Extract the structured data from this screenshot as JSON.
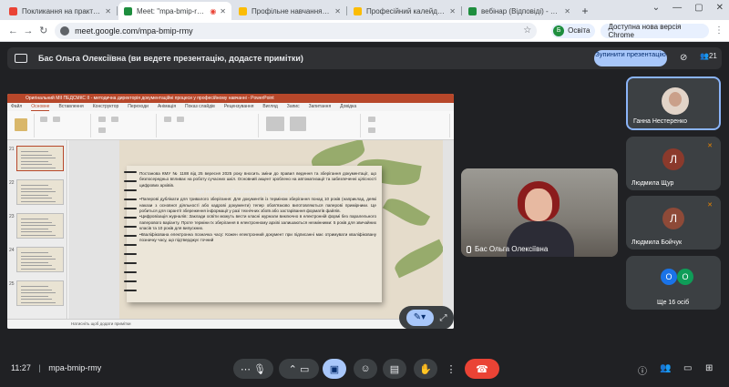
{
  "browser": {
    "tabs": [
      {
        "title": "Покликання на практикум - с",
        "color": "#ea4335",
        "active": false
      },
      {
        "title": "Meet: \"mpa-bmip-rmy\"",
        "color": "#1e8e3e",
        "active": true
      },
      {
        "title": "Профільне навчання - lino",
        "color": "#fbbc04",
        "active": false
      },
      {
        "title": "Професійний калейдоскоп - ",
        "color": "#fbbc04",
        "active": false
      },
      {
        "title": "вебінар (Відповіді) - Google Та",
        "color": "#1e8e3e",
        "active": false
      }
    ],
    "url": "meet.google.com/mpa-bmip-rmy",
    "profile_initial": "Б",
    "profile_label": "Освіта",
    "update_label": "Доступна нова версія Chrome"
  },
  "banner": {
    "text": "Бас Ольга Олексіївна (ви ведете презентацію, додасте примітки)",
    "stop_label": "Зупинити презентацію",
    "participants_count": "21"
  },
  "presentation": {
    "window_title": "Оригінальний МІІ ПЕДСМКС ІІ - методична директорія документаційні процеси у професійному навчанні - PowerPoint",
    "ribbon_tabs": [
      "Файл",
      "Основне",
      "Вставлення",
      "Конструктор",
      "Переходи",
      "Анімація",
      "Показ слайдів",
      "Рецензування",
      "Вигляд",
      "Запис",
      "Запитання",
      "Довідка"
    ],
    "active_ribbon_tab": "Основне",
    "thumb_numbers": [
      "21",
      "22",
      "23",
      "24",
      "25"
    ],
    "status": "Натисніть щоб додати примітки",
    "slide": {
      "intro": "Постанова КМУ № 1188 від 25 вересня 2025 року вносить зміни до правил ведення та зберігання документації, що безпосередньо впливає на роботу сучасних шкіл. Основний акцент зроблено на автоматизації та забезпеченні цілісності цифрових архівів.",
      "heading": "Що нового у зберіганні електронних документів:",
      "p1": "•Паперові дублікати для тривалого зберігання: Для документів із терміном зберігання понад 10 років (наприклад, деякі накази з основної діяльності або кадрові документи) тепер обов'язково виготовляються паперові примірники. Це робиться для гарантії збереження інформації у разі технічних збоїв або застарівання форматів файлів.",
      "p2": "•Цифровізація журналів: Заклади освіти можуть вести класні журнали виключно в електронній формі без паралельного паперового варіанту. Проте терміни їх зберігання в електронному архіві залишаються незмінними: 5 років для звичайних класів та 10 років для випускних.",
      "p3": "•Кваліфікована електронна позначка часу: Кожен електронний документ при підписанні має отримувати кваліфіковану позначку часу, що підтверджує точний"
    }
  },
  "presenter_tile": {
    "name": "Бас Ольга Олексіївна"
  },
  "participants": [
    {
      "name": "Ганна Нестеренко",
      "type": "photo",
      "speaking": true
    },
    {
      "name": "Людмила Щур",
      "initial": "Л",
      "color": "#8b3a2c",
      "type": "initial",
      "muted": true
    },
    {
      "name": "Людмила Бойчук",
      "initial": "Л",
      "color": "#8e4a38",
      "type": "initial",
      "muted": true
    },
    {
      "name": "Ще 16 осіб",
      "initials": [
        "О",
        "О"
      ],
      "colors": [
        "#1a73e8",
        "#0f9d58"
      ],
      "type": "more"
    }
  ],
  "bottom": {
    "time": "11:27",
    "meeting_code": "mpa-bmip-rmy"
  }
}
